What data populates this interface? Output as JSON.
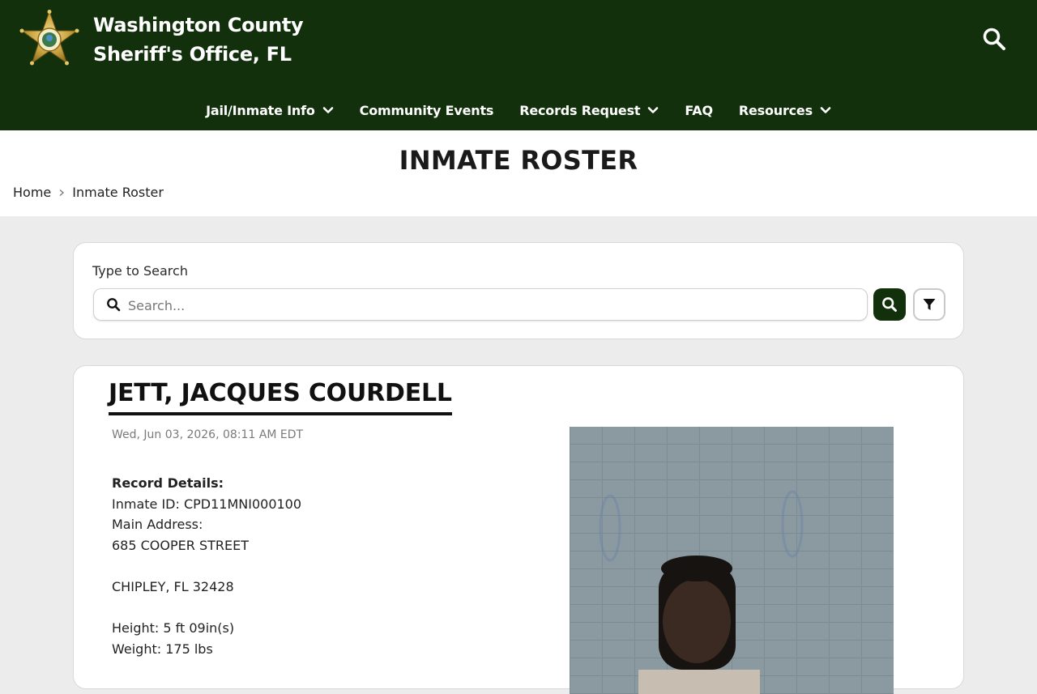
{
  "header": {
    "title_line1": "Washington County",
    "title_line2": "Sheriff's Office, FL"
  },
  "nav": {
    "items": [
      {
        "label": "Jail/Inmate Info",
        "has_dropdown": true
      },
      {
        "label": "Community Events",
        "has_dropdown": false
      },
      {
        "label": "Records Request",
        "has_dropdown": true
      },
      {
        "label": "FAQ",
        "has_dropdown": false
      },
      {
        "label": "Resources",
        "has_dropdown": true
      }
    ]
  },
  "page": {
    "title": "INMATE ROSTER",
    "breadcrumb": [
      "Home",
      "Inmate Roster"
    ]
  },
  "search": {
    "label": "Type to Search",
    "placeholder": "Search...",
    "value": ""
  },
  "inmate": {
    "name": "JETT, JACQUES COURDELL",
    "timestamp": "Wed, Jun 03, 2026, 08:11 AM EDT",
    "record_heading": "Record Details:",
    "inmate_id": "Inmate ID: CPD11MNI000100",
    "address_label": "Main Address:",
    "address_line1": "685 COOPER STREET",
    "address_line2": "CHIPLEY, FL 32428",
    "height": "Height: 5 ft 09in(s)",
    "weight": "Weight: 175 lbs"
  },
  "colors": {
    "brand_green": "#13300d",
    "page_bg": "#ececec",
    "card_bg": "#ffffff"
  },
  "icons": {
    "logo": "sheriff-star-badge",
    "header_search": "search-icon",
    "nav_dropdown": "chevron-down-icon",
    "breadcrumb_sep": "chevron-right-icon",
    "filter": "filter-icon"
  }
}
